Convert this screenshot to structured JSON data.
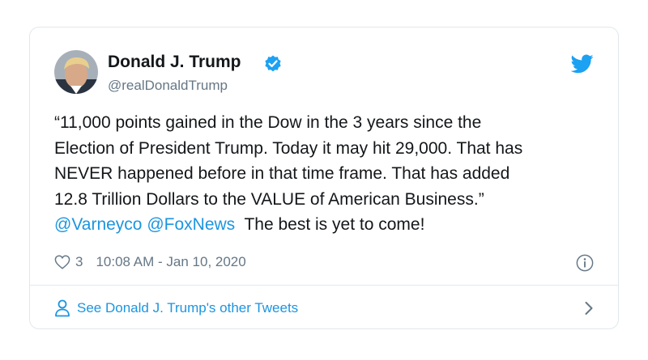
{
  "tweet": {
    "author": {
      "display_name": "Donald J. Trump",
      "handle": "@realDonaldTrump",
      "verified": true
    },
    "text_lines": [
      "“11,000 points gained in the Dow in the 3 years since the",
      "Election of President Trump. Today it may hit 29,000. That has",
      "NEVER happened before in that time frame. That has added",
      "12.8 Trillion Dollars to the VALUE of American Business.”"
    ],
    "mentions": [
      "@Varneyco",
      "@FoxNews"
    ],
    "text_tail": "The best is yet to come!",
    "like_count": "3",
    "timestamp": "10:08 AM - Jan 10, 2020"
  },
  "footer": {
    "label": "See Donald J. Trump's other Tweets"
  },
  "colors": {
    "accent": "#1b95e0",
    "twitter_blue": "#1da1f2",
    "muted": "#657786",
    "border": "#e1e8ed"
  },
  "icons": {
    "brand": "twitter-bird-icon",
    "verified": "verified-badge-icon",
    "like": "heart-icon",
    "info": "info-icon",
    "profile": "person-icon",
    "more": "chevron-right-icon"
  }
}
